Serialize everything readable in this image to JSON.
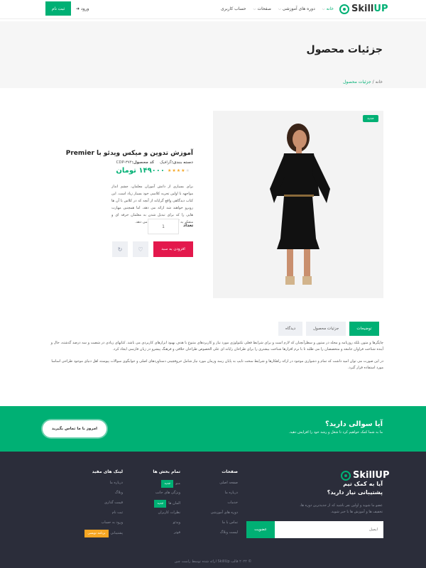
{
  "header": {
    "logo_prefix": "Skill",
    "logo_suffix": "UP",
    "nav": [
      {
        "label": "خانه",
        "active": true,
        "caret": true
      },
      {
        "label": "دوره های آموزشی",
        "active": false,
        "caret": true
      },
      {
        "label": "صفحات",
        "active": false,
        "caret": true
      },
      {
        "label": "حساب کاربری",
        "active": false,
        "caret": false
      }
    ],
    "login_label": "ورود",
    "signup_label": "ثبت نام"
  },
  "page_title": {
    "title": "جزئیات محصول",
    "breadcrumb_home": "خانه",
    "breadcrumb_sep": "/",
    "breadcrumb_current": "جزئیات محصول"
  },
  "product": {
    "badge": "جدید",
    "title": "آموزش تدوین و میکس ویدئو با Premier",
    "category_label": "دسته بندی:",
    "category": "گرافیک",
    "code_label": "کد محصول:",
    "code": "CDP-۳۷۴",
    "rating": 4,
    "rating_max": 5,
    "price": "۱۴۹۰۰۰ تومان",
    "description": "برای بسیاری از دانش آموزان معلمان، چشم انداز مواجهه با اولین تجربه کلاسی خود بسیار زیاد است. این کتاب دیدگاهی واقع گرایانه از آنچه که در کلاس با آن ها روبرو خواهند شد ارائه می دهد، اما همچنین مهارت هایی را که برای تبدیل شدن به معلمان حرفه ای و متفکر به آن ها نیاز دارند، ارائه می دهد.",
    "qty_label": "تعداد",
    "qty_value": "1",
    "add_to_cart": "افزودن به سبد"
  },
  "tabs": [
    {
      "label": "توضیحات",
      "active": true
    },
    {
      "label": "جزئیات محصول",
      "active": false
    },
    {
      "label": "دیدگاه",
      "active": false
    }
  ],
  "tab_content": {
    "p1": "چاپگرها و متون بلکه روزنامه و مجله در ستون و سطرآنچنان که لازم است و برای شرایط فعلی تکنولوژی مورد نیاز و کاربردهای متنوع با هدف بهبود ابزارهای کاربردی می باشد. کتابهای زیادی در شصت و سه درصد گذشته، حال و آینده شناخت فراوان جامعه و متخصصان را می طلبد تا با نرم افزارها شناخت بیشتری را برای طراحان رایانه ای علی الخصوص طراحان خلاقی و فرهنگ پیشرو در زبان فارسی ایجاد کرد.",
    "p2": "در این صورت می توان امید داشت که تمام و دشواری موجود در ارائه راهکارها و شرایط سخت تایپ به پایان رسد وزمان مورد نیاز شامل حروفچینی دستاوردهای اصلی و جوابگوی سوالات پیوسته اهل دنیای موجود طراحی اساسا مورد استفاده قرار گیرد."
  },
  "cta": {
    "title": "آیا سوالی دارید؟",
    "subtitle": "ما به شما کمک خواهیم کرد تا شغل و رشد خود را افزایش دهید.",
    "button": "امروز با ما تماس بگیرید"
  },
  "footer": {
    "heading": "آیا به کمک تیم پشتیبانی نیاز دارید؟",
    "subtext": "عضو ما شوید و اولین نفر باشید که از جدیدترین دوره ها، تخفیف ها و آموزش ها با خبر شوید.",
    "email_placeholder": "ایمیل",
    "subscribe": "عضویت",
    "col_pages": {
      "title": "صفحات",
      "items": [
        "صفحه اصلی",
        "درباره ما",
        "خدمات",
        "دوره های آموزشی",
        "تماس با ما",
        "لیست وبلاگ"
      ]
    },
    "col_sections": {
      "title": "تمام بخش ها",
      "items": [
        {
          "label": "منو",
          "tag": "جدید"
        },
        {
          "label": "ویژگی های جانب",
          "tag": ""
        },
        {
          "label": "المان ها",
          "tag": "جدید"
        },
        {
          "label": "نظرات کاربران",
          "tag": ""
        },
        {
          "label": "ویدئو",
          "tag": ""
        },
        {
          "label": "فوتر",
          "tag": ""
        }
      ]
    },
    "col_links": {
      "title": "لینک های مفید",
      "items": [
        {
          "label": "درباره ما",
          "tag": ""
        },
        {
          "label": "وبلاگ",
          "tag": ""
        },
        {
          "label": "قیمت گذاری",
          "tag": ""
        },
        {
          "label": "ثبت نام",
          "tag": ""
        },
        {
          "label": "ورود به حساب",
          "tag": ""
        },
        {
          "label": "پشتیبانی",
          "tag": "برنامه نویسی"
        }
      ]
    },
    "copyright": "© ۲۰۲۲ قالب SkillUp ارائه شده توسط راست چین"
  },
  "colors": {
    "accent": "#00b074",
    "cart": "#e3184c",
    "footer_bg": "#2b2d3a",
    "star": "#f5a623"
  }
}
